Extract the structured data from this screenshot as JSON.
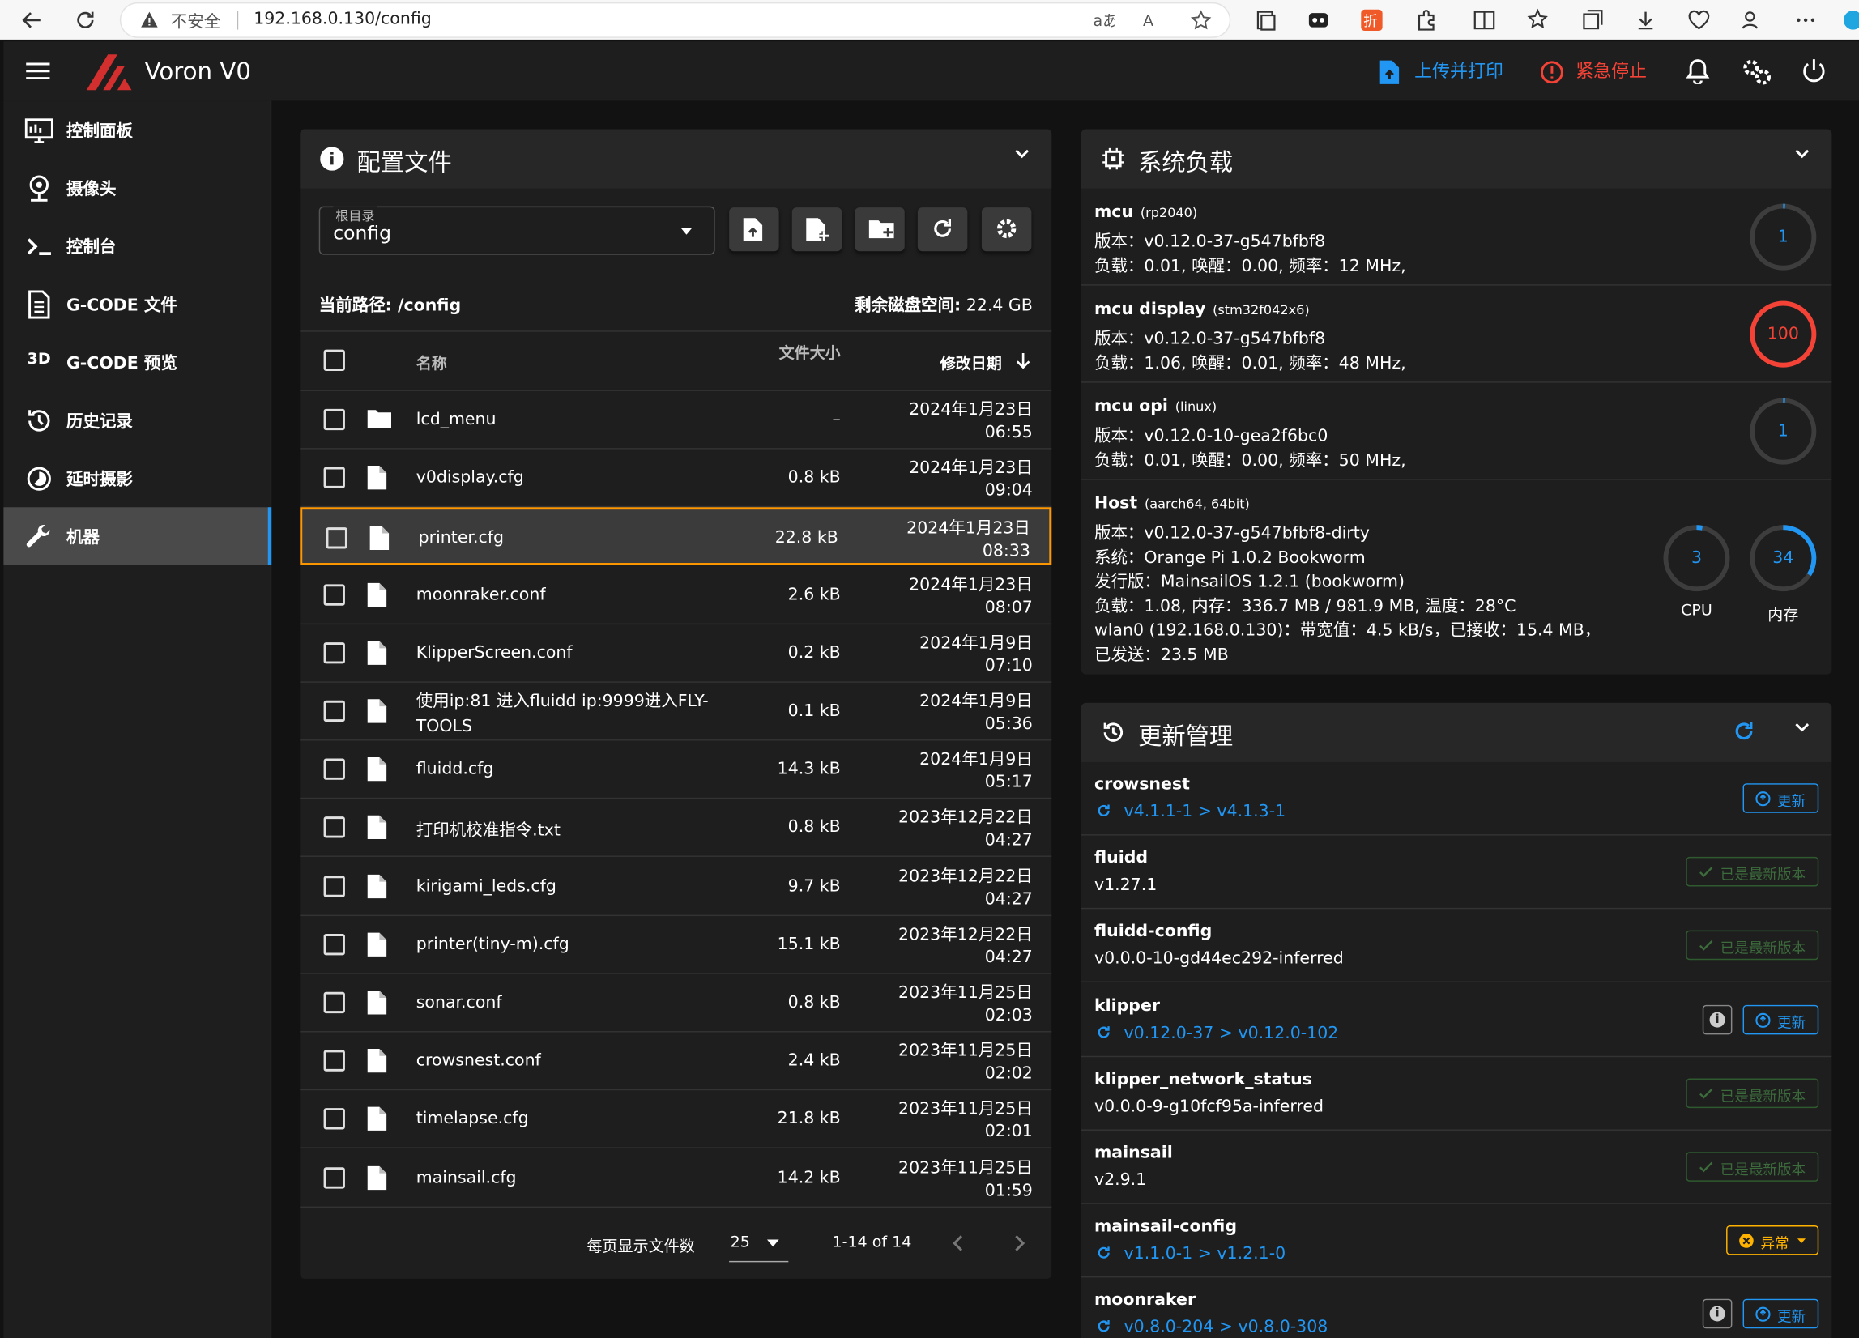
{
  "browser": {
    "insecure": "不安全",
    "url": "192.168.0.130/config"
  },
  "app": {
    "title": "Voron V0",
    "upload_print": "上传并打印",
    "emergency_stop": "紧急停止"
  },
  "sidebar": {
    "items": [
      {
        "label": "控制面板",
        "icon": "dashboard-icon"
      },
      {
        "label": "摄像头",
        "icon": "webcam-icon"
      },
      {
        "label": "控制台",
        "icon": "console-icon"
      },
      {
        "label": "G-CODE 文件",
        "icon": "file-icon"
      },
      {
        "label": "G-CODE 预览",
        "icon": "3d-icon",
        "prefix": "3D"
      },
      {
        "label": "历史记录",
        "icon": "history-icon"
      },
      {
        "label": "延时摄影",
        "icon": "timelapse-icon"
      },
      {
        "label": "机器",
        "icon": "wrench-icon"
      }
    ]
  },
  "files": {
    "title": "配置文件",
    "root_label": "根目录",
    "root_value": "config",
    "path_label": "当前路径: /config",
    "disk_label": "剩余磁盘空间:",
    "disk_value": "22.4 GB",
    "col_name": "名称",
    "col_size": "文件大小",
    "col_date": "修改日期",
    "rows": [
      {
        "name": "lcd_menu",
        "size": "–",
        "d1": "2024年1月23日",
        "d2": "06:55",
        "type": "folder"
      },
      {
        "name": "v0display.cfg",
        "size": "0.8 kB",
        "d1": "2024年1月23日",
        "d2": "09:04",
        "type": "file"
      },
      {
        "name": "printer.cfg",
        "size": "22.8 kB",
        "d1": "2024年1月23日",
        "d2": "08:33",
        "type": "file"
      },
      {
        "name": "moonraker.conf",
        "size": "2.6 kB",
        "d1": "2024年1月23日",
        "d2": "08:07",
        "type": "file"
      },
      {
        "name": "KlipperScreen.conf",
        "size": "0.2 kB",
        "d1": "2024年1月9日",
        "d2": "07:10",
        "type": "file"
      },
      {
        "name": "使用ip:81 进入fluidd ip:9999进入FLY-TOOLS",
        "size": "0.1 kB",
        "d1": "2024年1月9日",
        "d2": "05:36",
        "type": "file"
      },
      {
        "name": "fluidd.cfg",
        "size": "14.3 kB",
        "d1": "2024年1月9日",
        "d2": "05:17",
        "type": "file"
      },
      {
        "name": "打印机校准指令.txt",
        "size": "0.8 kB",
        "d1": "2023年12月22日",
        "d2": "04:27",
        "type": "file"
      },
      {
        "name": "kirigami_leds.cfg",
        "size": "9.7 kB",
        "d1": "2023年12月22日",
        "d2": "04:27",
        "type": "file"
      },
      {
        "name": "printer(tiny-m).cfg",
        "size": "15.1 kB",
        "d1": "2023年12月22日",
        "d2": "04:27",
        "type": "file"
      },
      {
        "name": "sonar.conf",
        "size": "0.8 kB",
        "d1": "2023年11月25日",
        "d2": "02:03",
        "type": "file"
      },
      {
        "name": "crowsnest.conf",
        "size": "2.4 kB",
        "d1": "2023年11月25日",
        "d2": "02:02",
        "type": "file"
      },
      {
        "name": "timelapse.cfg",
        "size": "21.8 kB",
        "d1": "2023年11月25日",
        "d2": "02:01",
        "type": "file"
      },
      {
        "name": "mainsail.cfg",
        "size": "14.2 kB",
        "d1": "2023年11月25日",
        "d2": "01:59",
        "type": "file"
      }
    ],
    "footer": {
      "per_page_label": "每页显示文件数",
      "per_page": "25",
      "range": "1-14 of 14"
    }
  },
  "system": {
    "title": "系统负载",
    "mcus": [
      {
        "name": "mcu",
        "chip": "(rp2040)",
        "l1": "版本：v0.12.0-37-g547bfbf8",
        "l2": "负载：0.01, 唤醒：0.00, 频率：12 MHz,",
        "gauge": "1",
        "gauge_value": 1
      },
      {
        "name": "mcu display",
        "chip": "(stm32f042x6)",
        "l1": "版本：v0.12.0-37-g547bfbf8",
        "l2": "负载：1.06, 唤醒：0.01, 频率：48 MHz,",
        "gauge": "100",
        "gauge_value": 100
      },
      {
        "name": "mcu opi",
        "chip": "(linux)",
        "l1": "版本：v0.12.0-10-gea2f6bc0",
        "l2": "负载：0.01, 唤醒：0.00, 频率：50 MHz,",
        "gauge": "1",
        "gauge_value": 1
      }
    ],
    "host": {
      "name": "Host",
      "chip": "(aarch64, 64bit)",
      "lines": [
        "版本：v0.12.0-37-g547bfbf8-dirty",
        "系统：Orange Pi 1.0.2 Bookworm",
        "发行版：MainsailOS 1.2.1 (bookworm)",
        "负载：1.08, 内存：336.7 MB / 981.9 MB, 温度：28°C",
        "wlan0 (192.168.0.130)：带宽值：4.5 kB/s，已接收：15.4 MB，",
        "已发送：23.5 MB"
      ],
      "cpu": "3",
      "cpu_value": 3,
      "cpu_label": "CPU",
      "mem": "34",
      "mem_value": 34,
      "mem_label": "内存"
    }
  },
  "updates": {
    "title": "更新管理",
    "update_label": "更新",
    "latest_label": "已是最新版本",
    "error_label": "异常",
    "rows": [
      {
        "name": "crowsnest",
        "ver": "v4.1.1-1 > v4.1.3-1",
        "state": "update",
        "info": false
      },
      {
        "name": "fluidd",
        "ver": "v1.27.1",
        "state": "latest",
        "info": false
      },
      {
        "name": "fluidd-config",
        "ver": "v0.0.0-10-gd44ec292-inferred",
        "state": "latest",
        "info": false
      },
      {
        "name": "klipper",
        "ver": "v0.12.0-37 > v0.12.0-102",
        "state": "update",
        "info": true
      },
      {
        "name": "klipper_network_status",
        "ver": "v0.0.0-9-g10fcf95a-inferred",
        "state": "latest",
        "info": false
      },
      {
        "name": "mainsail",
        "ver": "v2.9.1",
        "state": "latest",
        "info": false
      },
      {
        "name": "mainsail-config",
        "ver": "v1.1.0-1 > v1.2.1-0",
        "state": "error",
        "info": false
      },
      {
        "name": "moonraker",
        "ver": "v0.8.0-204 > v0.8.0-308",
        "state": "update",
        "info": true
      }
    ]
  },
  "colors": {
    "accent": "#2196f3",
    "error": "#f44336",
    "highlight": "#ff9800",
    "warn": "#ffb300"
  }
}
